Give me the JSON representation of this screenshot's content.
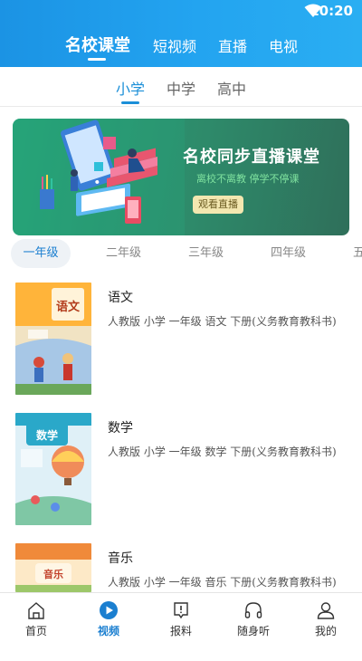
{
  "status": {
    "time": "10:20"
  },
  "top_nav": {
    "items": [
      "名校课堂",
      "短视频",
      "直播",
      "电视"
    ]
  },
  "grade_tabs": [
    "小学",
    "中学",
    "高中"
  ],
  "banner": {
    "title": "名校同步直播课堂",
    "subtitle": "离校不离教 停学不停课",
    "button": "观看直播"
  },
  "year_tabs": [
    "一年级",
    "二年级",
    "三年级",
    "四年级",
    "五"
  ],
  "books": [
    {
      "name": "语文",
      "desc": "人教版 小学 一年级 语文 下册(义务教育教科书)",
      "cover_title": "语文"
    },
    {
      "name": "数学",
      "desc": "人教版 小学 一年级 数学 下册(义务教育教科书)",
      "cover_title": "数学"
    },
    {
      "name": "音乐",
      "desc": "人教版 小学 一年级 音乐 下册(义务教育教科书)",
      "cover_title": "音乐"
    }
  ],
  "bottom_nav": [
    "首页",
    "视频",
    "报料",
    "随身听",
    "我的"
  ],
  "colors": {
    "primary": "#1b8fd8",
    "header_start": "#1b93e4",
    "banner_green": "#24a578"
  }
}
